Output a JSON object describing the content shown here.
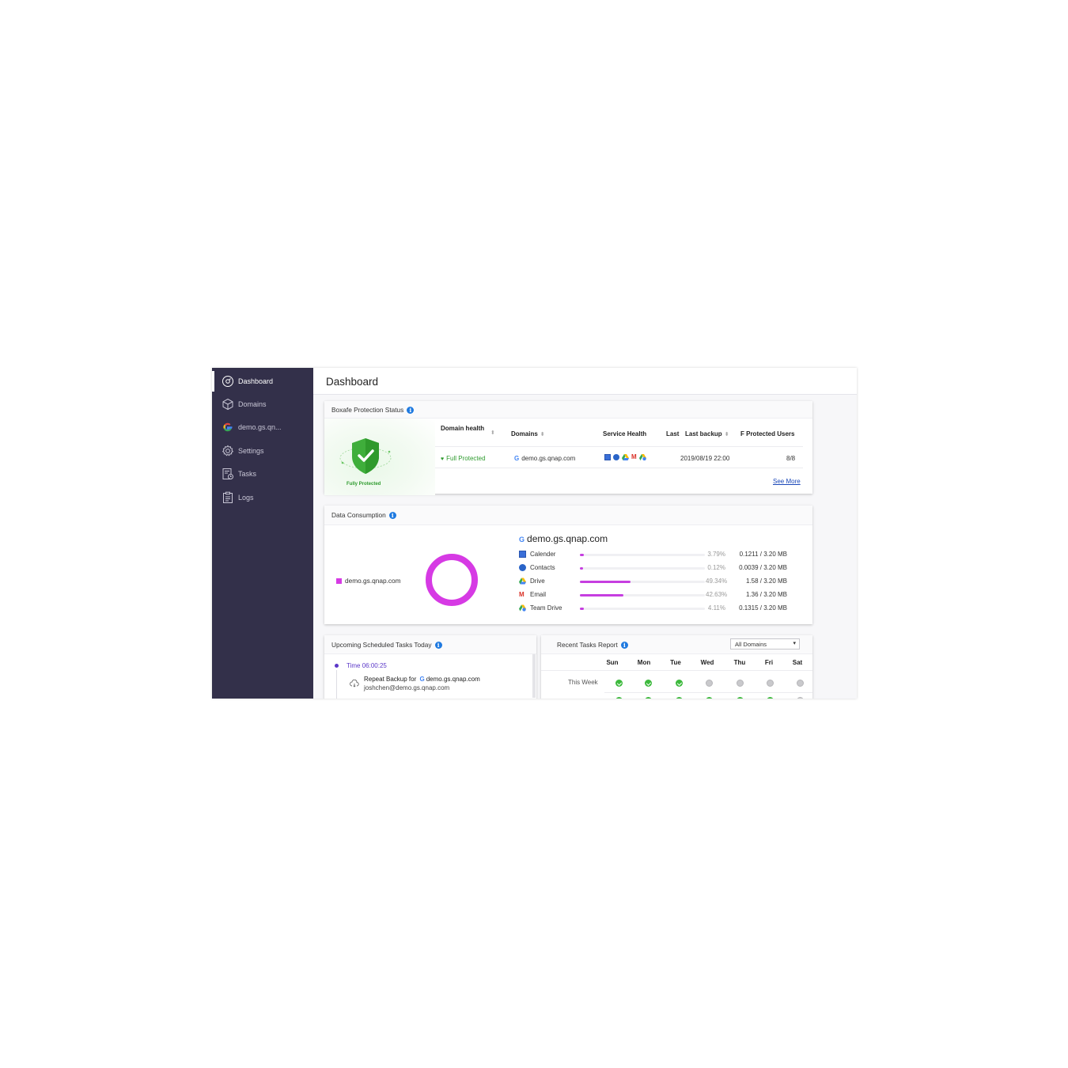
{
  "sidebar": {
    "items": [
      {
        "label": "Dashboard",
        "icon": "dashboard-icon"
      },
      {
        "label": "Domains",
        "icon": "cube-icon"
      },
      {
        "label": "demo.gs.qn...",
        "icon": "google-icon"
      },
      {
        "label": "Settings",
        "icon": "gear-icon"
      },
      {
        "label": "Tasks",
        "icon": "tasks-icon"
      },
      {
        "label": "Logs",
        "icon": "clipboard-icon"
      }
    ]
  },
  "header": {
    "title": "Dashboard"
  },
  "protection": {
    "title": "Boxafe Protection Status",
    "shield_label": "Fully Protected",
    "columns": {
      "domain_health": "Domain health",
      "domains": "Domains",
      "service_health": "Service Health",
      "last": "Last",
      "last_backup": "Last backup",
      "protected_users": "F Protected Users"
    },
    "row": {
      "health": "Full Protected",
      "domain": "demo.gs.qnap.com",
      "last_backup": "2019/08/19 22:00",
      "protected_users": "8/8"
    },
    "see_more": "See More"
  },
  "consumption": {
    "title": "Data Consumption",
    "legend_label": "demo.gs.qnap.com",
    "domain_title": "demo.gs.qnap.com",
    "colors": {
      "accent": "#c63ee0"
    },
    "services": [
      {
        "name": "Calender",
        "icon": "calendar-icon",
        "percent": "3.79%",
        "fraction": 0.0379,
        "size": "0.1211 / 3.20 MB"
      },
      {
        "name": "Contacts",
        "icon": "contacts-icon",
        "percent": "0.12%",
        "fraction": 0.0012,
        "size": "0.0039 / 3.20 MB"
      },
      {
        "name": "Drive",
        "icon": "drive-icon",
        "percent": "49.34%",
        "fraction": 0.4934,
        "size": "1.58 / 3.20 MB"
      },
      {
        "name": "Email",
        "icon": "gmail-icon",
        "percent": "42.63%",
        "fraction": 0.4263,
        "size": "1.36 / 3.20 MB"
      },
      {
        "name": "Team Drive",
        "icon": "team-drive-icon",
        "percent": "4.11%",
        "fraction": 0.0411,
        "size": "0.1315 / 3.20 MB"
      }
    ]
  },
  "upcoming": {
    "title": "Upcoming Scheduled Tasks Today",
    "time": "Time 06:00:25",
    "task_prefix": "Repeat Backup for",
    "task_domain": "demo.gs.qnap.com",
    "task_user": "joshchen@demo.gs.qnap.com"
  },
  "report": {
    "title": "Recent Tasks Report",
    "filter": "All Domains",
    "days": [
      "Sun",
      "Mon",
      "Tue",
      "Wed",
      "Thu",
      "Fri",
      "Sat"
    ],
    "row_label": "This Week",
    "this_week": [
      "ok",
      "ok",
      "ok",
      "none",
      "none",
      "none",
      "none"
    ]
  }
}
